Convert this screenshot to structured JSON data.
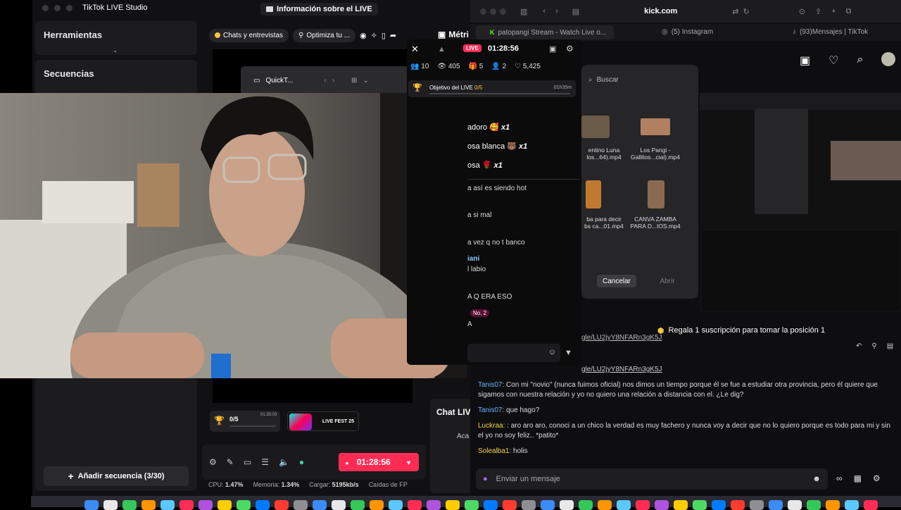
{
  "studio": {
    "app_title": "TikTok LIVE Studio",
    "live_info_label": "Información sobre el LIVE",
    "tools_title": "Herramientas",
    "sequences_title": "Secuencias",
    "tabs": [
      {
        "label": "Chats y entrevistas"
      },
      {
        "label": "Optimiza tu ..."
      }
    ],
    "metrics_label": "Métri",
    "quicktime_label": "QuickT...",
    "goal": {
      "label": "0/5",
      "time": "01:35:03"
    },
    "fest_label": "LIVE FEST 25",
    "timer": "01:28:56",
    "stats": {
      "cpu_label": "CPU:",
      "cpu_value": "1.47%",
      "mem_label": "Memoria:",
      "mem_value": "1.34%",
      "load_label": "Cargar:",
      "load_value": "5195kb/s",
      "drops_label": "Caídas de FP"
    },
    "add_sequence": "Añadir secuencia (3/30)",
    "chat_live_label": "Chat LIV",
    "aca_label": "Aca"
  },
  "chat_overlay": {
    "live_badge": "LIVE",
    "timer": "01:28:56",
    "counts": {
      "viewers": "10",
      "views": "405",
      "gifts": "5",
      "follows": "2",
      "likes": "5,425"
    },
    "goal_label": "Objetivo del LIVE",
    "goal_value": "0/5",
    "goal_time": "01h35m",
    "gift_lines": [
      {
        "text": "adoro",
        "icon": "heart-gift-emoji",
        "mult": "x1"
      },
      {
        "text": "osa blanca",
        "icon": "bear-gift-emoji",
        "mult": "x1"
      },
      {
        "text": "osa",
        "icon": "rose-gift-emoji",
        "mult": "x1"
      }
    ],
    "messages": [
      "a así es siendo hot",
      "a si mal",
      "a vez q no t banco",
      "iani",
      "l labio",
      "A Q ERA ESO",
      "No. 2",
      "A"
    ]
  },
  "kick": {
    "url": "kick.com",
    "tabs": [
      {
        "label": "patopangi Stream - Watch Live o..."
      },
      {
        "label": "(5) Instagram"
      },
      {
        "label": "(93)Mensajes | TikTok"
      }
    ],
    "subscription_banner": "Regala 1 suscripción para tomar la posición 1",
    "link_fragment": "gle/LU2jyY8NFARn3gK5J",
    "link_partial": "gle/LU2jyY8NFARn3gK5J",
    "chat": [
      {
        "user": "Tanis07",
        "text": "Con mi \"novio\" (nunca fuimos oficial) nos dimos un tiempo porque él se fue a estudiar otra provincia, pero él quiere que sigamos con nuestra relación y yo no quiero una relación a distancia con el. ¿Le dig?",
        "color": "#6fb2ff"
      },
      {
        "user": "Tanis07",
        "text": "que hago?",
        "color": "#6fb2ff"
      },
      {
        "user": "Luckraa:",
        "text": ": aro aro aro, conoci a un chico la verdad es muy fachero y nunca voy a decir que no lo quiero porque es todo para mi y sin el yo no soy feliz.. *patito*",
        "color": "#f5d547"
      },
      {
        "user": "Solealba1",
        "text": "holis",
        "color": "#f5d547"
      }
    ],
    "input_placeholder": "Enviar un mensaje"
  },
  "file_dialog": {
    "search_placeholder": "Buscar",
    "files": [
      {
        "name": "entino Luna\nlos...64).mp4"
      },
      {
        "name": "Los Pangi -\nGallitos...cial).mp4"
      },
      {
        "name": "ba para decir\nbs ca...01.mp4"
      },
      {
        "name": "CANVA ZAMBA\nPARA D...IOS.mp4"
      }
    ],
    "cancel": "Cancelar",
    "open": "Abrir"
  },
  "colors": {
    "accent": "#fe2c55",
    "kick_green": "#53fc18",
    "panel": "#1c1c1f"
  }
}
